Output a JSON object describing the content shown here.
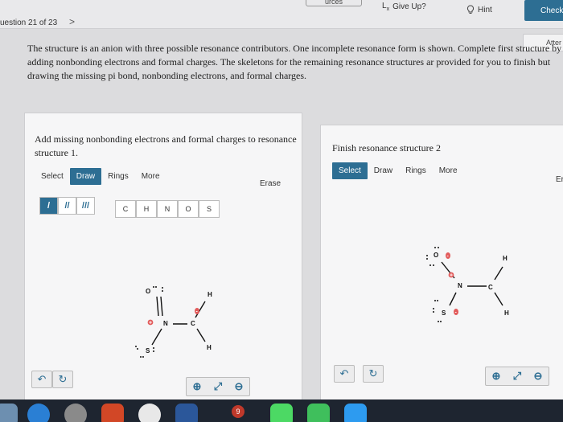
{
  "header": {
    "question_position": "uestion 21 of 23",
    "next_chevron": ">",
    "resources_label": "urces",
    "give_up_label": "Give Up?",
    "give_up_icon": "lx-icon",
    "hint_label": "Hint",
    "hint_icon": "lightbulb-icon",
    "check_label": "Check",
    "attempt_label": "Atter"
  },
  "prompt": {
    "text": "The structure is an anion with three possible resonance contributors. One incomplete resonance form is shown. Complete first structure by adding nonbonding electrons and formal charges. The skeletons for the remaining resonance structures ar provided for you to finish but drawing the missing pi bond, nonbonding electrons, and formal charges."
  },
  "left_panel": {
    "title": "Add missing nonbonding electrons and formal charges to resonance structure 1.",
    "tools": [
      "Select",
      "Draw",
      "Rings",
      "More"
    ],
    "active_tool": "Draw",
    "erase_label": "Erase",
    "bond_buttons": [
      "/",
      "//",
      "///"
    ],
    "atom_buttons": [
      "C",
      "H",
      "N",
      "O",
      "S"
    ],
    "molecule": {
      "atoms": {
        "o": "O",
        "n": "N",
        "c": "C",
        "s": "S",
        "h1": "H",
        "h2": "H"
      },
      "charges": {
        "n": "+",
        "c": "-"
      }
    }
  },
  "right_panel": {
    "title": "Finish resonance structure 2",
    "tools": [
      "Select",
      "Draw",
      "Rings",
      "More"
    ],
    "active_tool": "Select",
    "erase_label": "Er",
    "molecule": {
      "atoms": {
        "o": "O",
        "n": "N",
        "c": "C",
        "s": "S",
        "h1": "H",
        "h2": "H"
      },
      "charges": {
        "o": "-",
        "n": "+",
        "s": "-"
      }
    }
  },
  "footer_controls": {
    "undo_icon": "undo-icon",
    "redo_icon": "redo-icon",
    "zoom_in_icon": "zoom-in-icon",
    "reset_icon": "reset-zoom-icon",
    "zoom_out_icon": "zoom-out-icon"
  },
  "colors": {
    "accent": "#2d6e93",
    "charge": "#e25b5b",
    "dock": "#1e2530"
  },
  "dock_badge": "9"
}
